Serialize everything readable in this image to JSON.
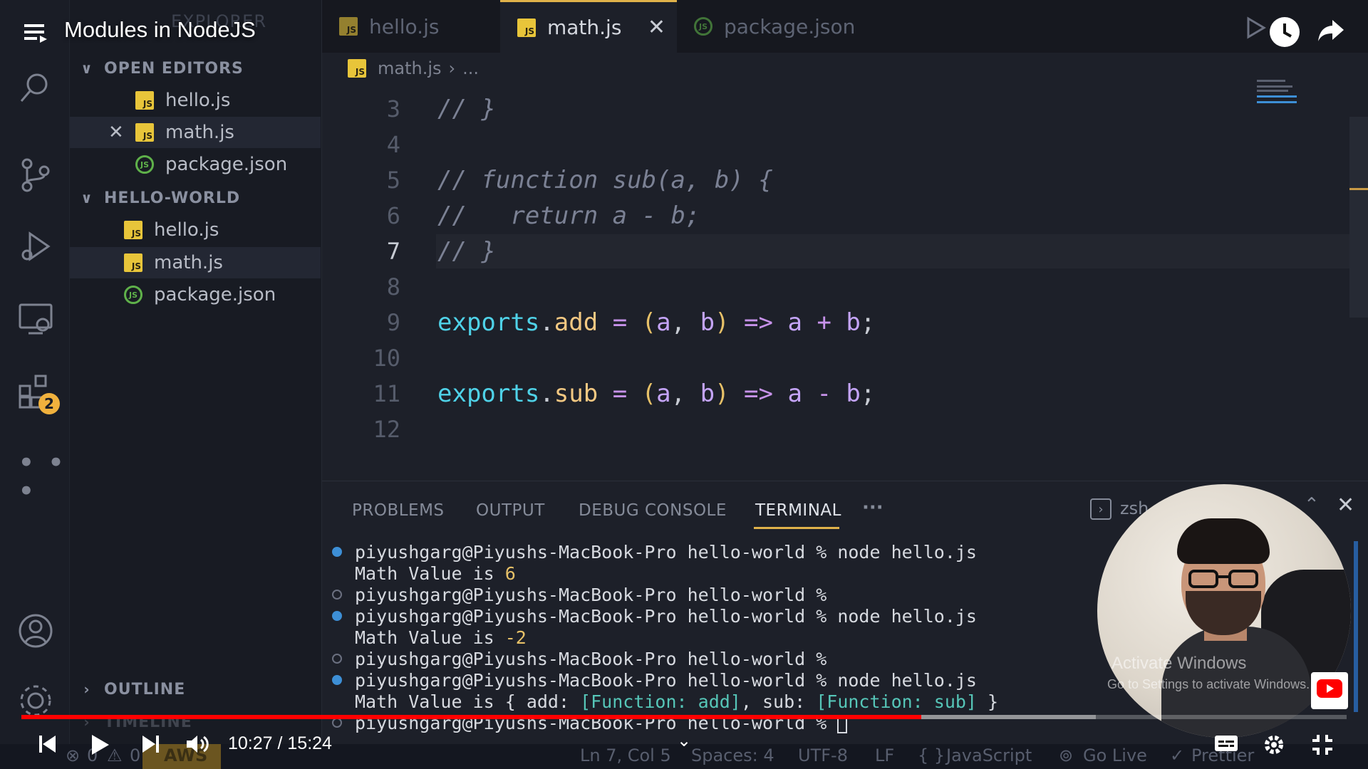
{
  "video": {
    "title": "Modules in NodeJS",
    "time": "10:27 / 15:24",
    "progress_fraction": 0.679,
    "buffered_fraction": 0.811
  },
  "activity_bar": {
    "items": [
      {
        "name": "explorer-icon"
      },
      {
        "name": "search-icon"
      },
      {
        "name": "source-control-icon"
      },
      {
        "name": "run-debug-icon"
      },
      {
        "name": "remote-explorer-icon"
      },
      {
        "name": "extensions-icon",
        "badge": "2"
      },
      {
        "name": "more-icon"
      },
      {
        "name": "account-icon"
      },
      {
        "name": "settings-gear-icon"
      }
    ]
  },
  "sidebar": {
    "faded_title": "EXPLORER",
    "open_editors": {
      "label": "OPEN EDITORS",
      "files": [
        {
          "name": "hello.js",
          "type": "js"
        },
        {
          "name": "math.js",
          "type": "js",
          "active": true
        },
        {
          "name": "package.json",
          "type": "json"
        }
      ]
    },
    "workspace": {
      "label": "HELLO-WORLD",
      "files": [
        {
          "name": "hello.js",
          "type": "js"
        },
        {
          "name": "math.js",
          "type": "js",
          "active": true
        },
        {
          "name": "package.json",
          "type": "json"
        }
      ]
    },
    "outline_label": "OUTLINE",
    "timeline_label": "TIMELINE"
  },
  "tabs": [
    {
      "label": "hello.js",
      "type": "js"
    },
    {
      "label": "math.js",
      "type": "js",
      "active": true
    },
    {
      "label": "package.json",
      "type": "json"
    }
  ],
  "breadcrumb": {
    "file": "math.js",
    "rest": "..."
  },
  "code_lines": [
    {
      "n": "3",
      "text": "// }"
    },
    {
      "n": "4",
      "text": ""
    },
    {
      "n": "5",
      "text": "// function sub(a, b) {"
    },
    {
      "n": "6",
      "text": "//   return a - b;"
    },
    {
      "n": "7",
      "text": "// }"
    },
    {
      "n": "8",
      "text": ""
    },
    {
      "n": "9",
      "text": "exports.add = (a, b) => a + b;"
    },
    {
      "n": "10",
      "text": ""
    },
    {
      "n": "11",
      "text": "exports.sub = (a, b) => a - b;"
    },
    {
      "n": "12",
      "text": ""
    }
  ],
  "panel": {
    "tabs": [
      "PROBLEMS",
      "OUTPUT",
      "DEBUG CONSOLE",
      "TERMINAL"
    ],
    "active_tab": "TERMINAL",
    "shell": "zsh",
    "terminal_lines": [
      {
        "dot": "blue",
        "prompt": "piyushgarg@Piyushs-MacBook-Pro hello-world % ",
        "cmd": "node hello.js"
      },
      {
        "dot": "",
        "out_prefix": "Math Value is ",
        "out_value": "6"
      },
      {
        "dot": "ring",
        "prompt": "piyushgarg@Piyushs-MacBook-Pro hello-world % ",
        "cmd": ""
      },
      {
        "dot": "blue",
        "prompt": "piyushgarg@Piyushs-MacBook-Pro hello-world % ",
        "cmd": "node hello.js"
      },
      {
        "dot": "",
        "out_prefix": "Math Value is ",
        "out_value": "-2"
      },
      {
        "dot": "ring",
        "prompt": "piyushgarg@Piyushs-MacBook-Pro hello-world % ",
        "cmd": ""
      },
      {
        "dot": "blue",
        "prompt": "piyushgarg@Piyushs-MacBook-Pro hello-world % ",
        "cmd": "node hello.js"
      },
      {
        "dot": "",
        "out_prefix": "Math Value is { add: ",
        "out_value": "[Function: add]",
        "out_mid": ", sub: ",
        "out_value2": "[Function: sub]",
        "out_suffix": " }"
      },
      {
        "dot": "ring",
        "prompt": "piyushgarg@Piyushs-MacBook-Pro hello-world % ",
        "cmd": "",
        "cursor": true
      }
    ]
  },
  "status_bar": {
    "errors": "0",
    "warnings": "0",
    "aws": "AWS",
    "position": "Ln 7, Col 5",
    "spaces": "Spaces: 4",
    "encoding": "UTF-8",
    "eol": "LF",
    "language": "JavaScript",
    "go_live": "Go Live",
    "prettier": "Prettier"
  },
  "watermark": {
    "line1": "Activate Windows",
    "line2": "Go to Settings to activate Windows."
  },
  "colors": {
    "accent_yellow": "#e0b24a",
    "progress_red": "#ff0000",
    "js_icon": "#e8c53a",
    "json_icon": "#5fb14a"
  }
}
